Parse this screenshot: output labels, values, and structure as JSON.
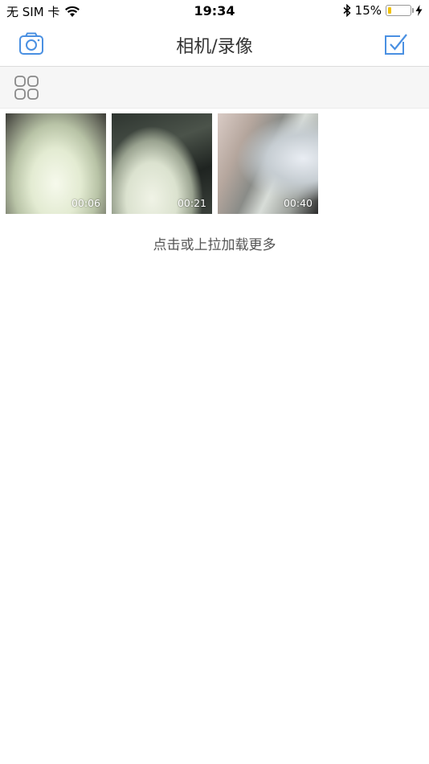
{
  "status_bar": {
    "carrier": "无 SIM 卡",
    "time": "19:34",
    "battery_percent": "15%",
    "battery_level": 0.15,
    "icons": [
      "wifi-icon",
      "bluetooth-icon",
      "battery-icon",
      "charging-bolt-icon"
    ]
  },
  "nav": {
    "title": "相机/录像",
    "left_icon": "camera-icon",
    "right_icon": "checkbox-select-icon",
    "accent_color": "#4a90e2"
  },
  "toolbar": {
    "icon": "grid-view-icon"
  },
  "videos": [
    {
      "duration": "00:06"
    },
    {
      "duration": "00:21"
    },
    {
      "duration": "00:40"
    }
  ],
  "load_more": "点击或上拉加载更多"
}
